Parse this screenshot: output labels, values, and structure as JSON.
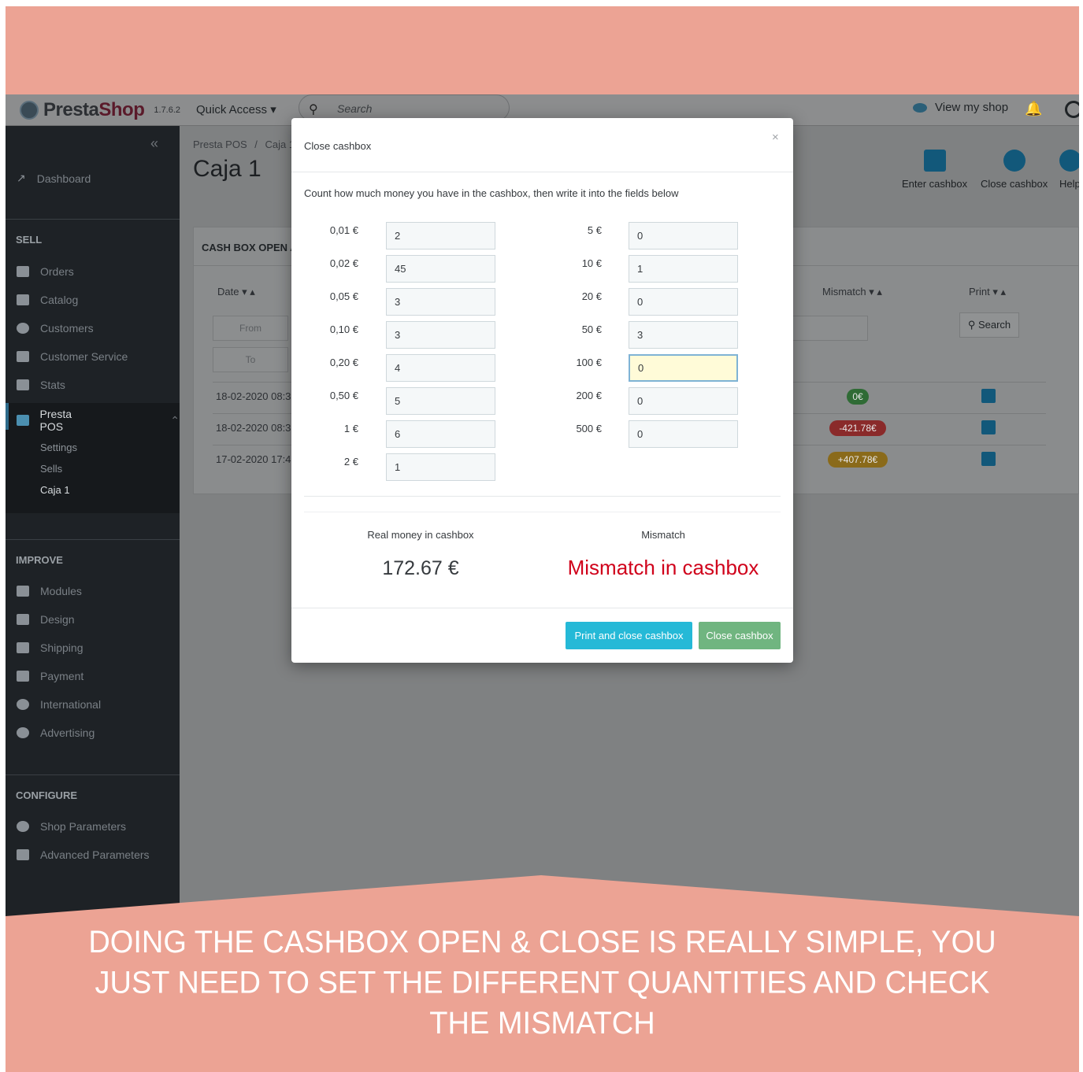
{
  "topbar": {
    "logo_text_1": "Presta",
    "logo_text_2": "Shop",
    "version": "1.7.6.2",
    "quick_access": "Quick Access ▾",
    "search_placeholder": "Search",
    "view_shop": "View my shop"
  },
  "sidebar": {
    "dashboard": "Dashboard",
    "sell_heading": "SELL",
    "sell_items": [
      "Orders",
      "Catalog",
      "Customers",
      "Customer Service",
      "Stats",
      "Presta POS"
    ],
    "pos_sub": [
      "Settings",
      "Sells",
      "Caja 1"
    ],
    "improve_heading": "IMPROVE",
    "improve_items": [
      "Modules",
      "Design",
      "Shipping",
      "Payment",
      "International",
      "Advertising"
    ],
    "configure_heading": "CONFIGURE",
    "configure_items": [
      "Shop Parameters",
      "Advanced Parameters"
    ]
  },
  "page": {
    "breadcrumb_1": "Presta POS",
    "breadcrumb_sep": "/",
    "breadcrumb_2": "Caja 1",
    "title": "Caja 1",
    "tools": [
      "Enter cashbox",
      "Close cashbox",
      "Help"
    ],
    "panel_title": "CASH BOX OPEN AND",
    "col_date": "Date ▾ ▴",
    "col_mismatch": "Mismatch ▾ ▴",
    "col_print": "Print ▾ ▴",
    "filter_from": "From",
    "filter_to": "To",
    "search_button": "Search",
    "rows": [
      {
        "date": "18-02-2020 08:3",
        "mismatch": "0€"
      },
      {
        "date": "18-02-2020 08:3",
        "mismatch": "-421.78€"
      },
      {
        "date": "17-02-2020 17:4",
        "mismatch": "+407.78€"
      }
    ]
  },
  "modal": {
    "title": "Close cashbox",
    "close": "×",
    "intro": "Count how much money you have in the cashbox, then write it into the fields below",
    "left": [
      {
        "label": "0,01 €",
        "value": "2"
      },
      {
        "label": "0,02 €",
        "value": "45"
      },
      {
        "label": "0,05 €",
        "value": "3"
      },
      {
        "label": "0,10 €",
        "value": "3"
      },
      {
        "label": "0,20 €",
        "value": "4"
      },
      {
        "label": "0,50 €",
        "value": "5"
      },
      {
        "label": "1 €",
        "value": "6"
      },
      {
        "label": "2 €",
        "value": "1"
      }
    ],
    "right": [
      {
        "label": "5 €",
        "value": "0"
      },
      {
        "label": "10 €",
        "value": "1"
      },
      {
        "label": "20 €",
        "value": "0"
      },
      {
        "label": "50 €",
        "value": "3"
      },
      {
        "label": "100 €",
        "value": "0"
      },
      {
        "label": "200 €",
        "value": "0"
      },
      {
        "label": "500 €",
        "value": "0"
      }
    ],
    "real_money_label": "Real money in cashbox",
    "real_money_value": "172.67 €",
    "mismatch_label": "Mismatch",
    "mismatch_value": "Mismatch in cashbox",
    "print_close_button": "Print and close cashbox",
    "close_button": "Close cashbox"
  },
  "caption": "DOING THE CASHBOX OPEN & CLOSE IS REALLY SIMPLE, YOU JUST NEED TO SET THE DIFFERENT QUANTITIES AND CHECK THE MISMATCH",
  "colors": {
    "background": "#eca394",
    "mismatch_red": "#d0021b",
    "button_blue": "#25b9d7",
    "button_green": "#70b580"
  }
}
